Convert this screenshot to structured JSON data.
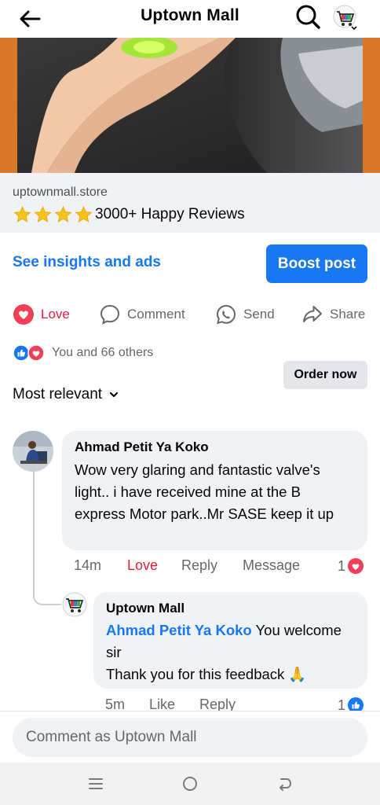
{
  "header": {
    "title": "Uptown Mall"
  },
  "link_preview": {
    "domain": "uptownmall.store",
    "stars": 4,
    "reviews_text": "3000+ Happy Reviews",
    "order_button": "Order now"
  },
  "insights_link": "See insights and ads",
  "boost_button": "Boost post",
  "actions": {
    "love": "Love",
    "comment": "Comment",
    "send": "Send",
    "share": "Share"
  },
  "reactions_summary": "You and 66 others",
  "sort_label": "Most relevant",
  "comments": [
    {
      "author": "Ahmad Petit Ya Koko",
      "text": "Wow very glaring and fantastic valve's light.. i have received mine at the B express Motor park..Mr SASE keep it up",
      "time": "14m",
      "reaction_label": "Love",
      "reply_label": "Reply",
      "message_label": "Message",
      "reaction_count": "1"
    }
  ],
  "reply": {
    "author": "Uptown Mall",
    "mention": "Ahmad Petit Ya Koko",
    "line1_rest": " You welcome sir",
    "line2": "Thank you for this feedback",
    "emoji": "🙏",
    "time": "5m",
    "like_label": "Like",
    "reply_label": "Reply",
    "reaction_count": "1"
  },
  "composer": {
    "placeholder": "Comment as Uptown Mall"
  },
  "colors": {
    "accent": "#1877f2",
    "love": "#e41e3f",
    "bubble": "#f0f2f5",
    "secondary_text": "#65676b"
  }
}
